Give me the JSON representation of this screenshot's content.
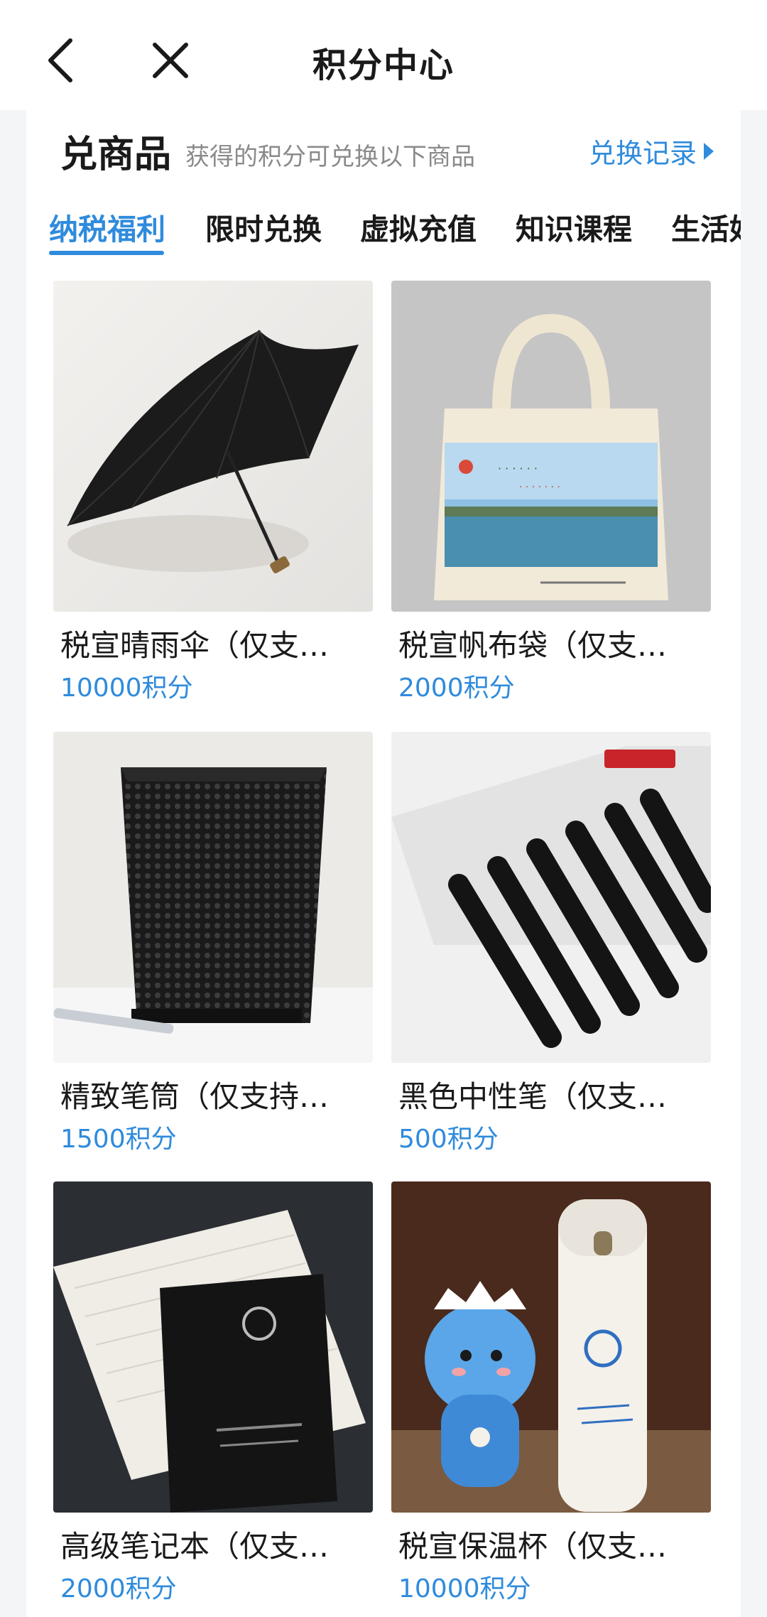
{
  "nav": {
    "title": "积分中心"
  },
  "section": {
    "title": "兑商品",
    "subtitle": "获得的积分可兑换以下商品",
    "history_link": "兑换记录"
  },
  "tabs": [
    {
      "label": "纳税福利",
      "active": true
    },
    {
      "label": "限时兑换",
      "active": false
    },
    {
      "label": "虚拟充值",
      "active": false
    },
    {
      "label": "知识课程",
      "active": false
    },
    {
      "label": "生活好",
      "active": false
    }
  ],
  "products": [
    {
      "name": "税宣晴雨伞（仅支…",
      "price": "10000积分",
      "image": "umbrella"
    },
    {
      "name": "税宣帆布袋（仅支…",
      "price": "2000积分",
      "image": "canvas-bag"
    },
    {
      "name": "精致笔筒（仅支持…",
      "price": "1500积分",
      "image": "pen-holder"
    },
    {
      "name": "黑色中性笔（仅支…",
      "price": "500积分",
      "image": "gel-pens"
    },
    {
      "name": "高级笔记本（仅支…",
      "price": "2000积分",
      "image": "notebook"
    },
    {
      "name": "税宣保温杯（仅支…",
      "price": "10000积分",
      "image": "thermos"
    }
  ],
  "colors": {
    "accent": "#2f8bdc",
    "background": "#f4f5f7"
  }
}
